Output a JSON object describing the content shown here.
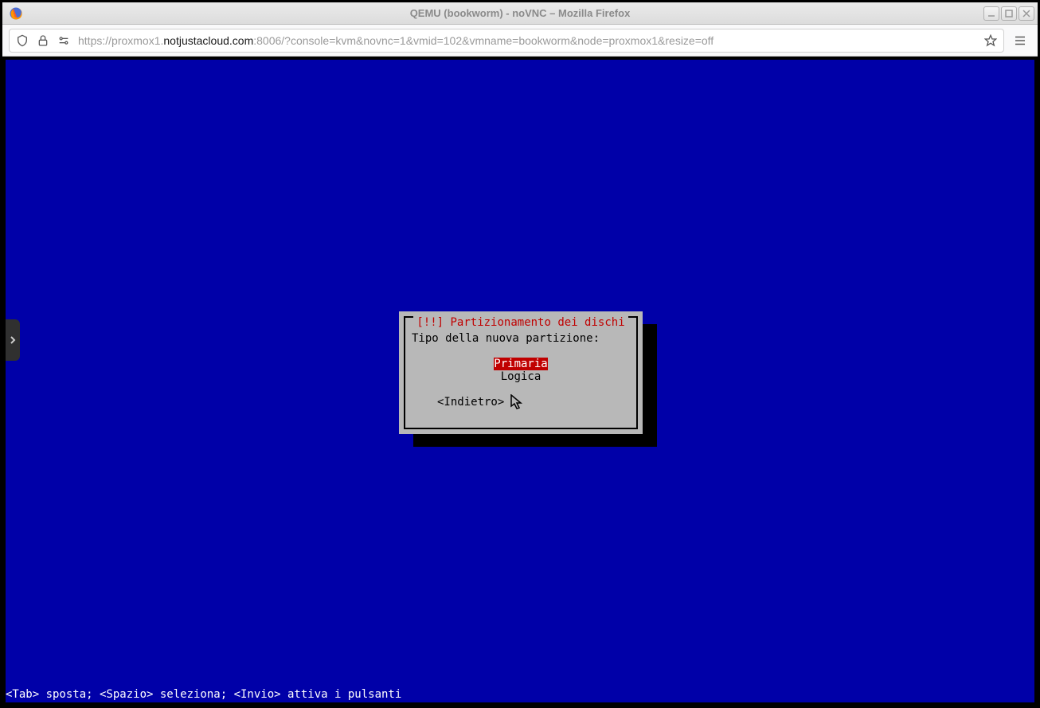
{
  "window": {
    "title": "QEMU (bookworm) - noVNC – Mozilla Firefox"
  },
  "url": {
    "scheme": "https://",
    "host_prefix": "proxmox1.",
    "host_bold": "notjustacloud.com",
    "port_path": ":8006/?console=kvm&novnc=1&vmid=102&vmname=bookworm&node=proxmox1&resize=off"
  },
  "dialog": {
    "title": "[!!] Partizionamento dei dischi",
    "prompt": "Tipo della nuova partizione:",
    "options": {
      "primary": "Primaria",
      "logical": "Logica"
    },
    "back": "<Indietro>"
  },
  "help_line": "<Tab> sposta; <Spazio> seleziona; <Invio> attiva i pulsanti"
}
